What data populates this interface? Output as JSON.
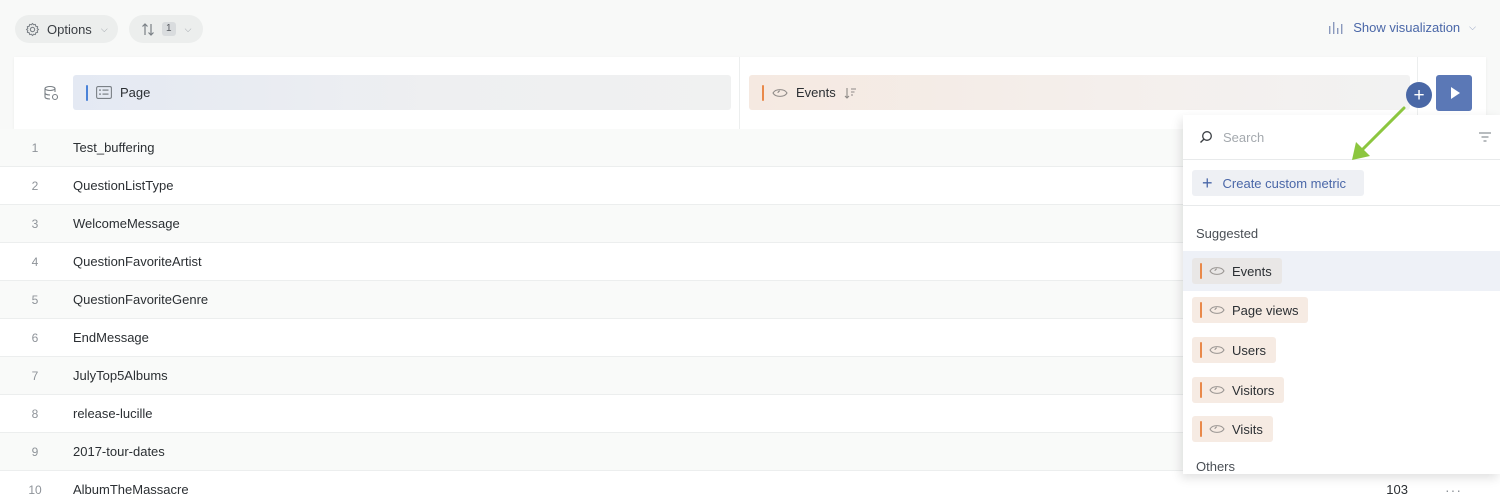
{
  "toolbar": {
    "options_label": "Options",
    "sort_count": "1",
    "show_visualization_label": "Show visualization"
  },
  "header": {
    "dimension_label": "Page",
    "metric_label": "Events"
  },
  "rows": [
    {
      "num": "1",
      "page": "Test_buffering",
      "events": ""
    },
    {
      "num": "2",
      "page": "QuestionListType",
      "events": ""
    },
    {
      "num": "3",
      "page": "WelcomeMessage",
      "events": ""
    },
    {
      "num": "4",
      "page": "QuestionFavoriteArtist",
      "events": ""
    },
    {
      "num": "5",
      "page": "QuestionFavoriteGenre",
      "events": ""
    },
    {
      "num": "6",
      "page": "EndMessage",
      "events": ""
    },
    {
      "num": "7",
      "page": "JulyTop5Albums",
      "events": ""
    },
    {
      "num": "8",
      "page": "release-lucille",
      "events": ""
    },
    {
      "num": "9",
      "page": "2017-tour-dates",
      "events": ""
    },
    {
      "num": "10",
      "page": "AlbumTheMassacre",
      "events": "103"
    }
  ],
  "row_more_label": "···",
  "panel": {
    "search_placeholder": "Search",
    "create_label": "Create custom metric",
    "suggested_label": "Suggested",
    "others_label": "Others",
    "metrics": [
      {
        "label": "Events",
        "selected": true
      },
      {
        "label": "Page views",
        "selected": false
      },
      {
        "label": "Users",
        "selected": false
      },
      {
        "label": "Visitors",
        "selected": false
      },
      {
        "label": "Visits",
        "selected": false
      }
    ]
  },
  "colors": {
    "accent": "#4a68a6",
    "dimension_bar": "#4a82d8",
    "metric_bar": "#e9894a",
    "annotation_arrow": "#8cc63f"
  }
}
